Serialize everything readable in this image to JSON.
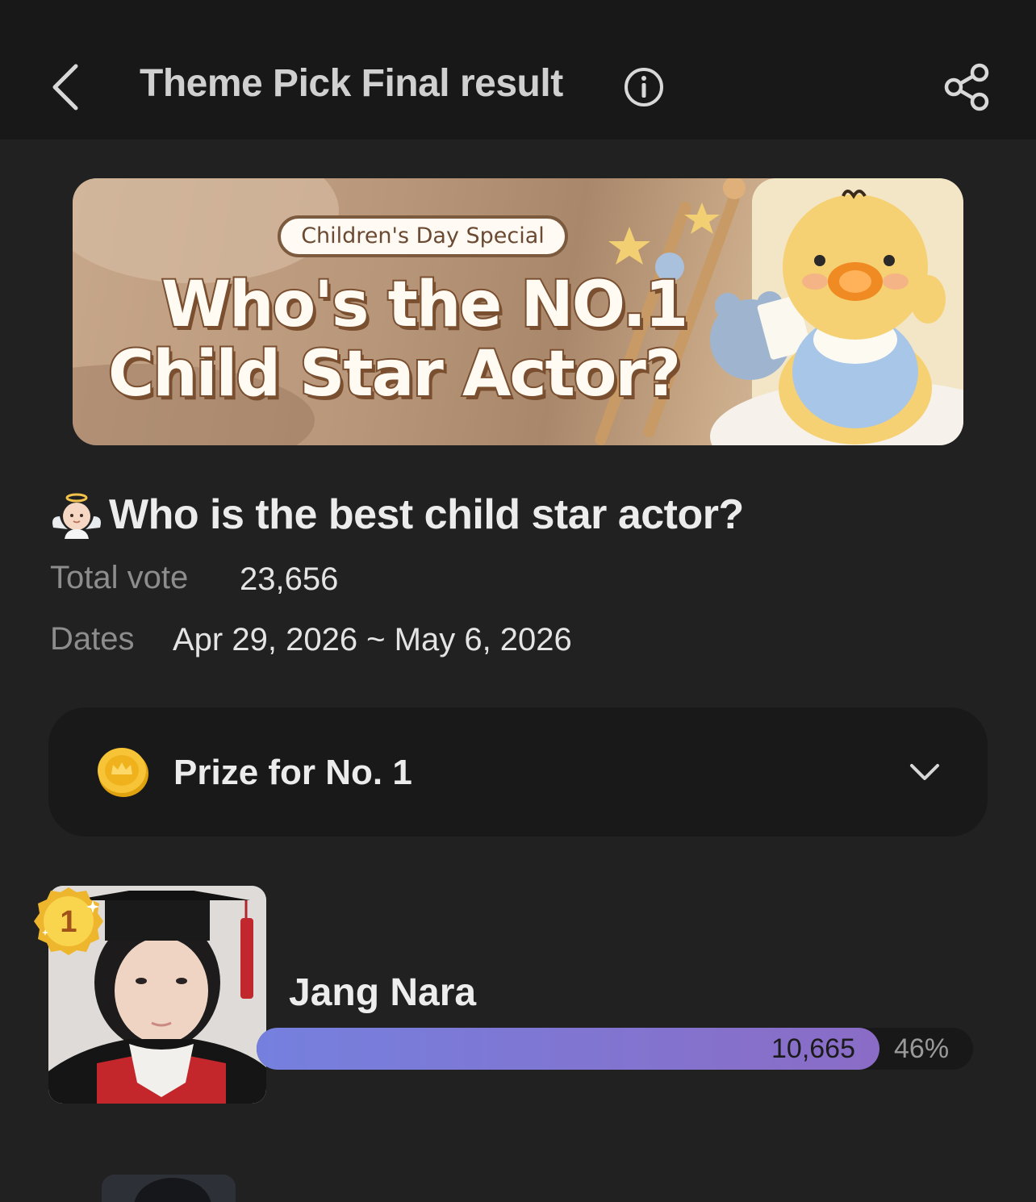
{
  "header": {
    "title": "Theme Pick Final result",
    "back_icon": "chevron-left-icon",
    "info_icon": "info-icon",
    "share_icon": "share-icon"
  },
  "banner": {
    "tag": "Children's Day Special",
    "line1": "Who's the NO.1",
    "line2": "Child Star Actor?"
  },
  "question": {
    "emoji": "baby-angel-emoji",
    "text": "Who is the best child star actor?"
  },
  "stats": {
    "total_vote_label": "Total vote",
    "total_vote_value": "23,656",
    "dates_label": "Dates",
    "dates_value": "Apr 29, 2026 ~ May 6, 2026"
  },
  "prize": {
    "icon": "coin-icon",
    "label": "Prize for No. 1",
    "expand_icon": "chevron-down-icon"
  },
  "ranking": [
    {
      "rank": "1",
      "name": "Jang Nara",
      "votes": "10,665",
      "percent": "46%",
      "share": 0.46
    }
  ],
  "colors": {
    "background": "#212121",
    "header": "#181818",
    "bar_start": "#7580de",
    "bar_end": "#8a6cc6",
    "medal": "#f4c430"
  }
}
